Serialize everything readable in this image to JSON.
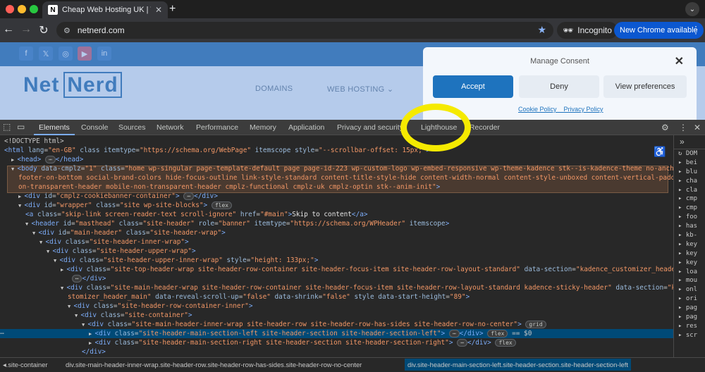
{
  "browser": {
    "tab_title": "Cheap Web Hosting UK | Web",
    "tab_favicon_letter": "N",
    "url": "netnerd.com",
    "incognito_label": "Incognito",
    "new_chrome_label": "New Chrome available"
  },
  "site": {
    "logo_net": "Net",
    "logo_nerd": "Nerd",
    "nav": [
      "DOMAINS",
      "WEB HOSTING ⌄"
    ],
    "social_icons": [
      "f",
      "𝕏",
      "◎",
      "▶",
      "in"
    ]
  },
  "consent": {
    "title": "Manage Consent",
    "accept": "Accept",
    "deny": "Deny",
    "preferences": "View preferences",
    "cookie_policy": "Cookie Policy",
    "privacy_policy": "Privacy Policy"
  },
  "devtools": {
    "tabs": [
      "Elements",
      "Console",
      "Sources",
      "Network",
      "Performance",
      "Memory",
      "Application",
      "Privacy and security",
      "Lighthouse",
      "Recorder"
    ],
    "sidebar_items": [
      "DOM",
      "bei",
      "blu",
      "cha",
      "cla",
      "cmp",
      "cmp",
      "foo",
      "has",
      "kb-",
      "key",
      "key",
      "key",
      "loa",
      "mou",
      "onl",
      "ori",
      "pag",
      "pag",
      "res",
      "scr"
    ],
    "breadcrumbs": [
      ".site-container",
      "div.site-main-header-inner-wrap.site-header-row.site-header-row-has-sides.site-header-row-no-center",
      "div.site-header-main-section-left.site-header-section.site-header-section-left"
    ],
    "dom_lines": [
      {
        "indent": 0,
        "parts": [
          [
            "c",
            "<!DOCTYPE html>"
          ]
        ]
      },
      {
        "indent": 0,
        "parts": [
          [
            "t",
            "<html "
          ],
          [
            "a",
            "lang"
          ],
          [
            "c",
            "="
          ],
          [
            "v",
            "\"en-GB\""
          ],
          [
            "a",
            " class itemtype"
          ],
          [
            "c",
            "="
          ],
          [
            "v",
            "\"https://schema.org/WebPage\""
          ],
          [
            "a",
            " itemscope style"
          ],
          [
            "c",
            "="
          ],
          [
            "v",
            "\"--scrollbar-offset: 15px;\""
          ],
          [
            "t",
            ">"
          ]
        ]
      },
      {
        "indent": 1,
        "arrow": "▶",
        "parts": [
          [
            "t",
            "<head>"
          ],
          [
            "p",
            "⋯"
          ],
          [
            "t",
            "</head>"
          ]
        ]
      },
      {
        "indent": 1,
        "arrow": "▼",
        "parts": [
          [
            "t",
            "<body "
          ],
          [
            "a",
            "data-cmplz"
          ],
          [
            "c",
            "="
          ],
          [
            "v",
            "\"1\""
          ],
          [
            "a",
            " class"
          ],
          [
            "c",
            "="
          ],
          [
            "v",
            "\"home wp-singular page-template-default page page-id-223 wp-custom-logo wp-embed-responsive wp-theme-kadence stk--is-kadence-theme no-anchor-scroll"
          ]
        ]
      },
      {
        "indent": 2,
        "parts": [
          [
            "v",
            "footer-on-bottom social-brand-colors hide-focus-outline link-style-standard content-title-style-hide content-width-normal content-style-unboxed content-vertical-padding-hide n"
          ]
        ]
      },
      {
        "indent": 2,
        "parts": [
          [
            "v",
            "on-transparent-header mobile-non-transparent-header cmplz-functional cmplz-uk cmplz-optin stk--anim-init\""
          ],
          [
            "t",
            ">"
          ]
        ]
      },
      {
        "indent": 2,
        "arrow": "▶",
        "parts": [
          [
            "t",
            "<div "
          ],
          [
            "a",
            "id"
          ],
          [
            "c",
            "="
          ],
          [
            "v",
            "\"cmplz-cookiebanner-container\""
          ],
          [
            "t",
            ">"
          ],
          [
            "p",
            "⋯"
          ],
          [
            "t",
            "</div>"
          ]
        ]
      },
      {
        "indent": 2,
        "arrow": "▼",
        "parts": [
          [
            "t",
            "<div "
          ],
          [
            "a",
            "id"
          ],
          [
            "c",
            "="
          ],
          [
            "v",
            "\"wrapper\""
          ],
          [
            "a",
            " class"
          ],
          [
            "c",
            "="
          ],
          [
            "v",
            "\"site wp-site-blocks\""
          ],
          [
            "t",
            ">"
          ],
          [
            "p",
            "flex"
          ]
        ]
      },
      {
        "indent": 3,
        "parts": [
          [
            "t",
            "<a "
          ],
          [
            "a",
            "class"
          ],
          [
            "c",
            "="
          ],
          [
            "v",
            "\"skip-link screen-reader-text scroll-ignore\""
          ],
          [
            "a",
            " href"
          ],
          [
            "c",
            "="
          ],
          [
            "v",
            "\"#main\""
          ],
          [
            "t",
            ">"
          ],
          [
            "x",
            "Skip to content"
          ],
          [
            "t",
            "</a>"
          ]
        ]
      },
      {
        "indent": 3,
        "arrow": "▼",
        "parts": [
          [
            "t",
            "<header "
          ],
          [
            "a",
            "id"
          ],
          [
            "c",
            "="
          ],
          [
            "v",
            "\"masthead\""
          ],
          [
            "a",
            " class"
          ],
          [
            "c",
            "="
          ],
          [
            "v",
            "\"site-header\""
          ],
          [
            "a",
            " role"
          ],
          [
            "c",
            "="
          ],
          [
            "v",
            "\"banner\""
          ],
          [
            "a",
            " itemtype"
          ],
          [
            "c",
            "="
          ],
          [
            "v",
            "\"https://schema.org/WPHeader\""
          ],
          [
            "a",
            " itemscope"
          ],
          [
            "t",
            ">"
          ]
        ]
      },
      {
        "indent": 4,
        "arrow": "▼",
        "parts": [
          [
            "t",
            "<div "
          ],
          [
            "a",
            "id"
          ],
          [
            "c",
            "="
          ],
          [
            "v",
            "\"main-header\""
          ],
          [
            "a",
            " class"
          ],
          [
            "c",
            "="
          ],
          [
            "v",
            "\"site-header-wrap\""
          ],
          [
            "t",
            ">"
          ]
        ]
      },
      {
        "indent": 5,
        "arrow": "▼",
        "parts": [
          [
            "t",
            "<div "
          ],
          [
            "a",
            "class"
          ],
          [
            "c",
            "="
          ],
          [
            "v",
            "\"site-header-inner-wrap\""
          ],
          [
            "t",
            ">"
          ]
        ]
      },
      {
        "indent": 6,
        "arrow": "▼",
        "parts": [
          [
            "t",
            "<div "
          ],
          [
            "a",
            "class"
          ],
          [
            "c",
            "="
          ],
          [
            "v",
            "\"site-header-upper-wrap\""
          ],
          [
            "t",
            ">"
          ]
        ]
      },
      {
        "indent": 7,
        "arrow": "▼",
        "parts": [
          [
            "t",
            "<div "
          ],
          [
            "a",
            "class"
          ],
          [
            "c",
            "="
          ],
          [
            "v",
            "\"site-header-upper-inner-wrap\""
          ],
          [
            "a",
            " style"
          ],
          [
            "c",
            "="
          ],
          [
            "v",
            "\"height: 133px;\""
          ],
          [
            "t",
            ">"
          ]
        ]
      },
      {
        "indent": 8,
        "arrow": "▶",
        "parts": [
          [
            "t",
            "<div "
          ],
          [
            "a",
            "class"
          ],
          [
            "c",
            "="
          ],
          [
            "v",
            "\"site-top-header-wrap site-header-row-container site-header-focus-item site-header-row-layout-standard\""
          ],
          [
            "a",
            " data-section"
          ],
          [
            "c",
            "="
          ],
          [
            "v",
            "\"kadence_customizer_header_top\""
          ],
          [
            "t",
            ">"
          ]
        ]
      },
      {
        "indent": 9,
        "parts": [
          [
            "p",
            "⋯"
          ],
          [
            "t",
            "</div>"
          ]
        ]
      },
      {
        "indent": 8,
        "arrow": "▼",
        "parts": [
          [
            "t",
            "<div "
          ],
          [
            "a",
            "class"
          ],
          [
            "c",
            "="
          ],
          [
            "v",
            "\"site-main-header-wrap site-header-row-container site-header-focus-item site-header-row-layout-standard kadence-sticky-header\""
          ],
          [
            "a",
            " data-section"
          ],
          [
            "c",
            "="
          ],
          [
            "v",
            "\"kadence_cu"
          ]
        ]
      },
      {
        "indent": 9,
        "parts": [
          [
            "v",
            "stomizer_header_main\""
          ],
          [
            "a",
            " data-reveal-scroll-up"
          ],
          [
            "c",
            "="
          ],
          [
            "v",
            "\"false\""
          ],
          [
            "a",
            " data-shrink"
          ],
          [
            "c",
            "="
          ],
          [
            "v",
            "\"false\""
          ],
          [
            "a",
            " style data-start-height"
          ],
          [
            "c",
            "="
          ],
          [
            "v",
            "\"89\""
          ],
          [
            "t",
            ">"
          ]
        ]
      },
      {
        "indent": 9,
        "arrow": "▼",
        "parts": [
          [
            "t",
            "<div "
          ],
          [
            "a",
            "class"
          ],
          [
            "c",
            "="
          ],
          [
            "v",
            "\"site-header-row-container-inner\""
          ],
          [
            "t",
            ">"
          ]
        ]
      },
      {
        "indent": 10,
        "arrow": "▼",
        "parts": [
          [
            "t",
            "<div "
          ],
          [
            "a",
            "class"
          ],
          [
            "c",
            "="
          ],
          [
            "v",
            "\"site-container\""
          ],
          [
            "t",
            ">"
          ]
        ]
      },
      {
        "indent": 11,
        "arrow": "▼",
        "parts": [
          [
            "t",
            "<div "
          ],
          [
            "a",
            "class"
          ],
          [
            "c",
            "="
          ],
          [
            "v",
            "\"site-main-header-inner-wrap site-header-row site-header-row-has-sides site-header-row-no-center\""
          ],
          [
            "t",
            ">"
          ],
          [
            "p",
            "grid"
          ]
        ]
      },
      {
        "indent": 12,
        "arrow": "▶",
        "selected": true,
        "parts": [
          [
            "t",
            "<div "
          ],
          [
            "a",
            "class"
          ],
          [
            "c",
            "="
          ],
          [
            "v",
            "\"site-header-main-section-left site-header-section site-header-section-left\""
          ],
          [
            "t",
            ">"
          ],
          [
            "p",
            "⋯"
          ],
          [
            "t",
            "</div>"
          ],
          [
            "p",
            "flex"
          ],
          [
            "c",
            " == $0"
          ]
        ]
      },
      {
        "indent": 12,
        "arrow": "▶",
        "parts": [
          [
            "t",
            "<div "
          ],
          [
            "a",
            "class"
          ],
          [
            "c",
            "="
          ],
          [
            "v",
            "\"site-header-main-section-right site-header-section site-header-section-right\""
          ],
          [
            "t",
            ">"
          ],
          [
            "p",
            "⋯"
          ],
          [
            "t",
            "</div>"
          ],
          [
            "p",
            "flex"
          ]
        ]
      },
      {
        "indent": 11,
        "parts": [
          [
            "t",
            "</div>"
          ]
        ]
      }
    ]
  }
}
